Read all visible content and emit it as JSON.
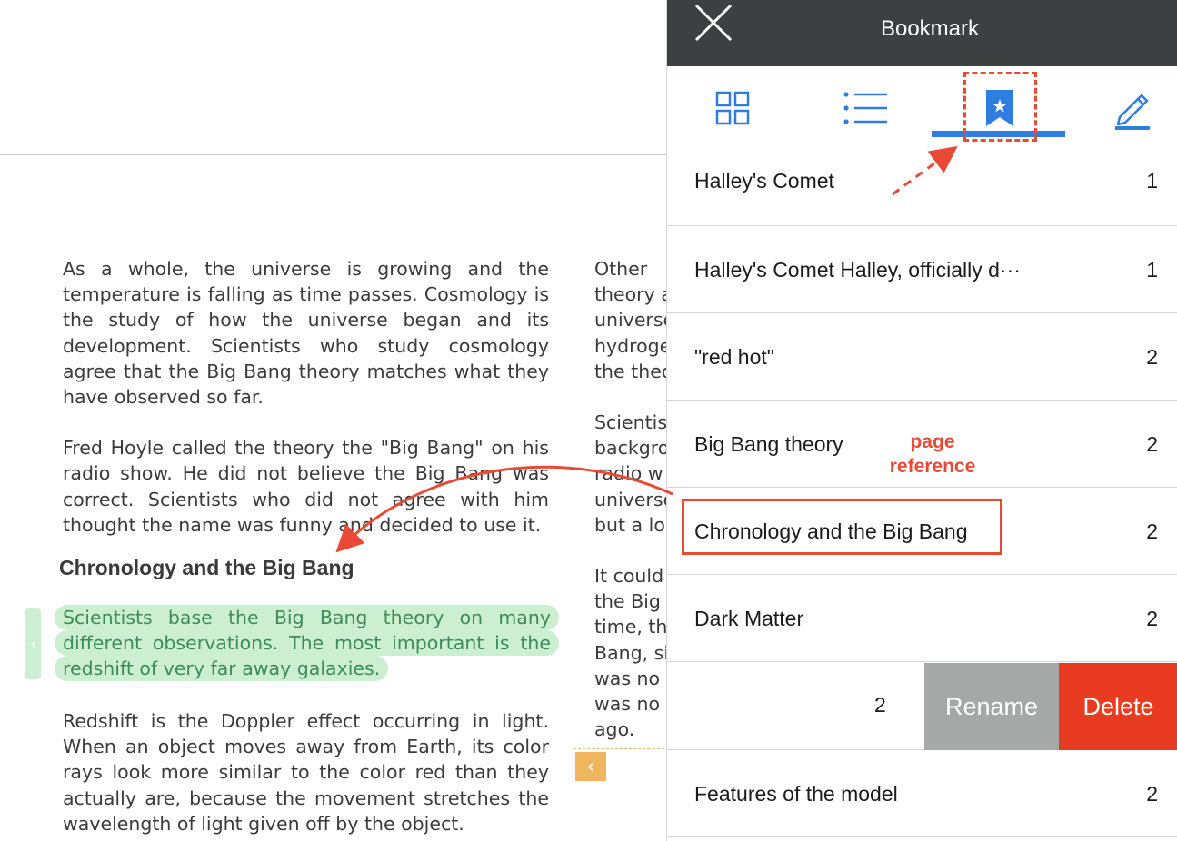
{
  "reader": {
    "col1_paragraphs": [
      "As a whole, the universe is growing and the temperature is falling as time passes. Cosmology is the study of how the universe began and its development. Scientists who study cosmology agree that the Big Bang theory matches what they have observed so far.",
      "Fred Hoyle called the theory the \"Big Bang\" on his radio show. He did not believe the Big Bang was correct. Scientists who did not agree with him thought the name was funny and decided to use it."
    ],
    "heading": "Chronology and the Big Bang",
    "highlight_lines": [
      "Scientists base the Big Bang theory on many",
      "different observations. The most important is the",
      "redshift of very far away galaxies."
    ],
    "highlight_handle_glyph": "‹",
    "col1_after": "Redshift is the Doppler effect occurring in light. When an object moves away from Earth, its color rays look more similar to the color red than they actually are, because the movement stretches the wavelength of light given off by the object.",
    "col2_block1": [
      "Other",
      "theory a",
      "universe",
      "hydroge",
      "the theo"
    ],
    "col2_block2": [
      "Scientis",
      "backgro",
      "radio w",
      "universe",
      "but a lo"
    ],
    "col2_block3": [
      "It could",
      "the Big",
      "time, th",
      "Bang, si",
      "was no",
      "was no",
      "ago."
    ],
    "prev_page_glyph": "‹"
  },
  "panel": {
    "title": "Bookmark",
    "tabs": {
      "thumbnails": "grid-icon",
      "toc": "list-icon",
      "bookmarks": "bookmark-star-icon",
      "notes": "pencil-icon"
    },
    "active_tab": "bookmarks",
    "bookmarks": [
      {
        "label": "Halley's Comet",
        "page": "1"
      },
      {
        "label": "Halley's Comet Halley, officially d···",
        "page": "1"
      },
      {
        "label": "\"red hot\"",
        "page": "2"
      },
      {
        "label": "Big Bang theory",
        "page": "2"
      },
      {
        "label": "Chronology and the Big Bang",
        "page": "2"
      },
      {
        "label": "Dark Matter",
        "page": "2"
      }
    ],
    "swiped_row": {
      "page": "2",
      "rename_label": "Rename",
      "delete_label": "Delete"
    },
    "last_row": {
      "label": "Features of the model",
      "page": "2"
    }
  },
  "annotation": {
    "text_line1": "page",
    "text_line2": "reference",
    "color": "#e84a35"
  },
  "colors": {
    "header_bg": "#3d4040",
    "accent_blue": "#2f7de1",
    "highlight_bg": "#cdefd1",
    "highlight_text": "#3c8d56",
    "rename_bg": "#a6a8a8",
    "delete_bg": "#e83b22",
    "prev_btn": "#f0b65e"
  }
}
